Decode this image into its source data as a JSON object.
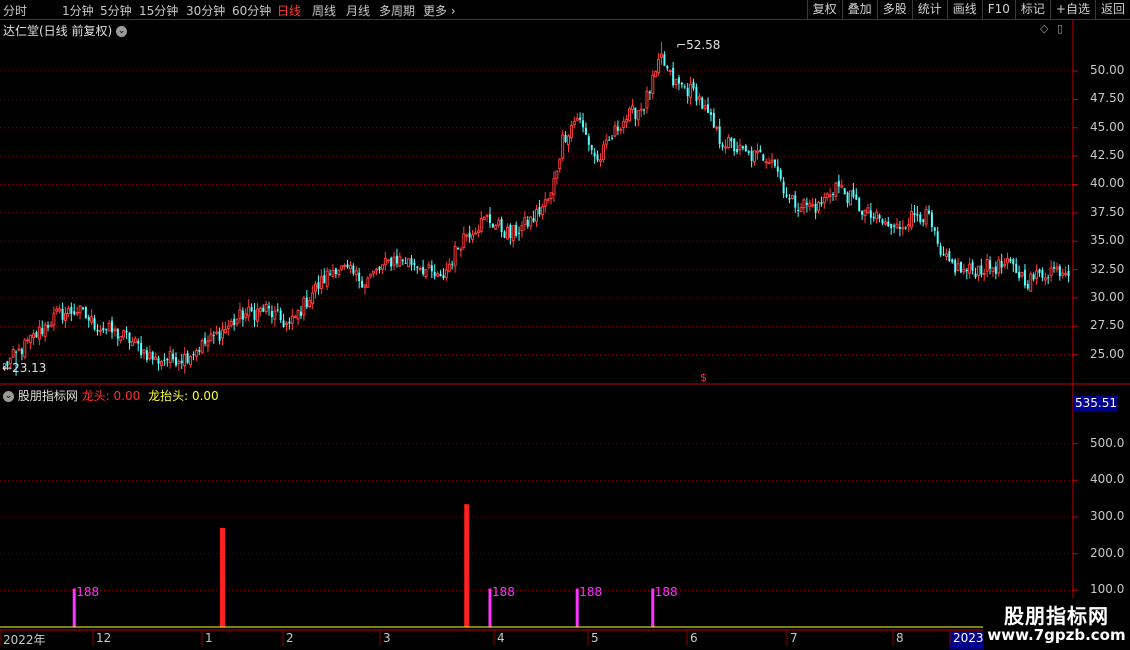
{
  "toolbar": {
    "periods": [
      "分时",
      "1分钟",
      "5分钟",
      "15分钟",
      "30分钟",
      "60分钟",
      "日线",
      "周线",
      "月线",
      "多周期",
      "更多"
    ],
    "active_period": "日线",
    "buttons": [
      "复权",
      "叠加",
      "多股",
      "统计",
      "画线",
      "F10",
      "标记",
      "+自选",
      "返回"
    ]
  },
  "main_panel": {
    "title": "达仁堂(日线 前复权)",
    "price_axis_labels": [
      "50.00",
      "47.50",
      "45.00",
      "42.50",
      "40.00",
      "37.50",
      "35.00",
      "32.50",
      "30.00",
      "27.50",
      "25.00"
    ],
    "high_label": "52.58",
    "low_label": "23.13",
    "marker": "$"
  },
  "indicator_panel": {
    "title": "股朋指标网",
    "legend": [
      {
        "name": "龙头:",
        "value": "0.00",
        "color": "#ff3030"
      },
      {
        "name": "龙抬头:",
        "value": "0.00",
        "color": "#ffff33"
      }
    ],
    "current_value": "535.51",
    "axis_labels": [
      "500.0",
      "400.0",
      "300.0",
      "200.0",
      "100.0"
    ]
  },
  "time_axis": {
    "labels": [
      "2022年",
      "12",
      "1",
      "2",
      "3",
      "4",
      "5",
      "6",
      "7",
      "8",
      "2023/"
    ]
  },
  "watermark": {
    "title": "股朋指标网",
    "url": "www.7gpzb.com"
  },
  "colors": {
    "up": "#ff3c3c",
    "down": "#54ffff",
    "grid": "#8b0000",
    "bar_red": "#ff2020",
    "bar_magenta": "#ff33ff"
  },
  "chart_data": [
    {
      "type": "candlestick",
      "title": "达仁堂(日线 前复权)",
      "ylim": [
        22.5,
        54.5
      ],
      "high": 52.58,
      "low": 23.13,
      "trend_points": [
        {
          "i": 0,
          "v": 24.0
        },
        {
          "i": 10,
          "v": 26.5
        },
        {
          "i": 18,
          "v": 28.5
        },
        {
          "i": 25,
          "v": 28.9
        },
        {
          "i": 32,
          "v": 27.5
        },
        {
          "i": 42,
          "v": 26.5
        },
        {
          "i": 52,
          "v": 24.5
        },
        {
          "i": 62,
          "v": 24.8
        },
        {
          "i": 72,
          "v": 26.5
        },
        {
          "i": 82,
          "v": 28.5
        },
        {
          "i": 90,
          "v": 29.0
        },
        {
          "i": 98,
          "v": 27.5
        },
        {
          "i": 106,
          "v": 30.5
        },
        {
          "i": 114,
          "v": 32.8
        },
        {
          "i": 124,
          "v": 31.5
        },
        {
          "i": 134,
          "v": 33.5
        },
        {
          "i": 142,
          "v": 33.0
        },
        {
          "i": 150,
          "v": 31.5
        },
        {
          "i": 158,
          "v": 35.5
        },
        {
          "i": 166,
          "v": 37.0
        },
        {
          "i": 174,
          "v": 35.5
        },
        {
          "i": 182,
          "v": 37.0
        },
        {
          "i": 188,
          "v": 39.0
        },
        {
          "i": 192,
          "v": 44.0
        },
        {
          "i": 197,
          "v": 46.0
        },
        {
          "i": 204,
          "v": 42.0
        },
        {
          "i": 212,
          "v": 45.5
        },
        {
          "i": 220,
          "v": 47.0
        },
        {
          "i": 226,
          "v": 51.0
        },
        {
          "i": 230,
          "v": 49.0
        },
        {
          "i": 238,
          "v": 48.0
        },
        {
          "i": 246,
          "v": 44.0
        },
        {
          "i": 256,
          "v": 42.5
        },
        {
          "i": 264,
          "v": 42.5
        },
        {
          "i": 270,
          "v": 38.5
        },
        {
          "i": 280,
          "v": 38.0
        },
        {
          "i": 286,
          "v": 40.0
        },
        {
          "i": 296,
          "v": 37.5
        },
        {
          "i": 306,
          "v": 36.0
        },
        {
          "i": 314,
          "v": 37.5
        },
        {
          "i": 318,
          "v": 37.0
        },
        {
          "i": 322,
          "v": 33.5
        },
        {
          "i": 330,
          "v": 32.3
        },
        {
          "i": 338,
          "v": 32.7
        },
        {
          "i": 346,
          "v": 32.8
        },
        {
          "i": 352,
          "v": 31.5
        },
        {
          "i": 360,
          "v": 32.5
        },
        {
          "i": 366,
          "v": 32.5
        }
      ],
      "candle_count": 367
    },
    {
      "type": "bar",
      "title": "股朋指标网",
      "ylim": [
        0,
        600
      ],
      "bars": [
        {
          "i": 24,
          "v": 105,
          "color": "magenta",
          "label": "188"
        },
        {
          "i": 75,
          "v": 270,
          "color": "red"
        },
        {
          "i": 159,
          "v": 335,
          "color": "red"
        },
        {
          "i": 167,
          "v": 105,
          "color": "magenta",
          "label": "188"
        },
        {
          "i": 197,
          "v": 105,
          "color": "magenta",
          "label": "188"
        },
        {
          "i": 223,
          "v": 105,
          "color": "magenta",
          "label": "188"
        }
      ]
    }
  ]
}
